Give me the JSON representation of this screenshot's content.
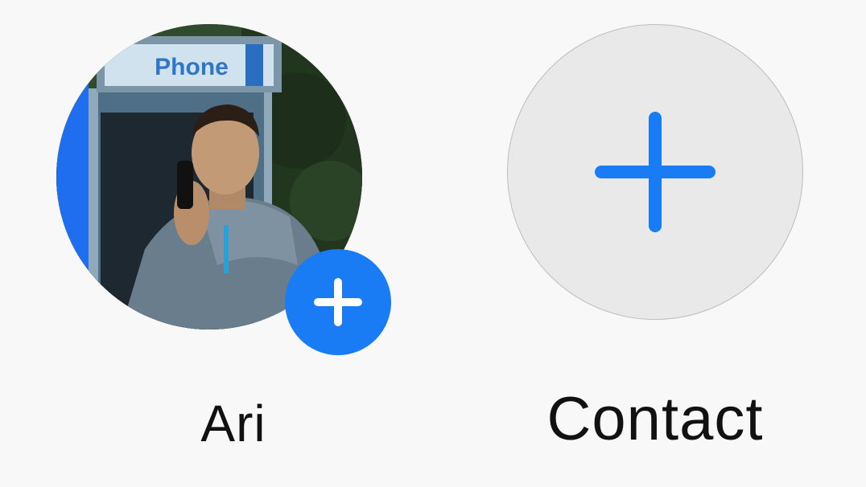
{
  "contacts": [
    {
      "name": "Ari",
      "photo_sign_text": "Phone",
      "badge_icon": "plus-icon"
    },
    {
      "name": "Contact",
      "icon": "plus-icon"
    }
  ],
  "colors": {
    "accent": "#1a7cf5",
    "background": "#f8f8f8",
    "placeholder_fill": "#e9e9e9"
  }
}
